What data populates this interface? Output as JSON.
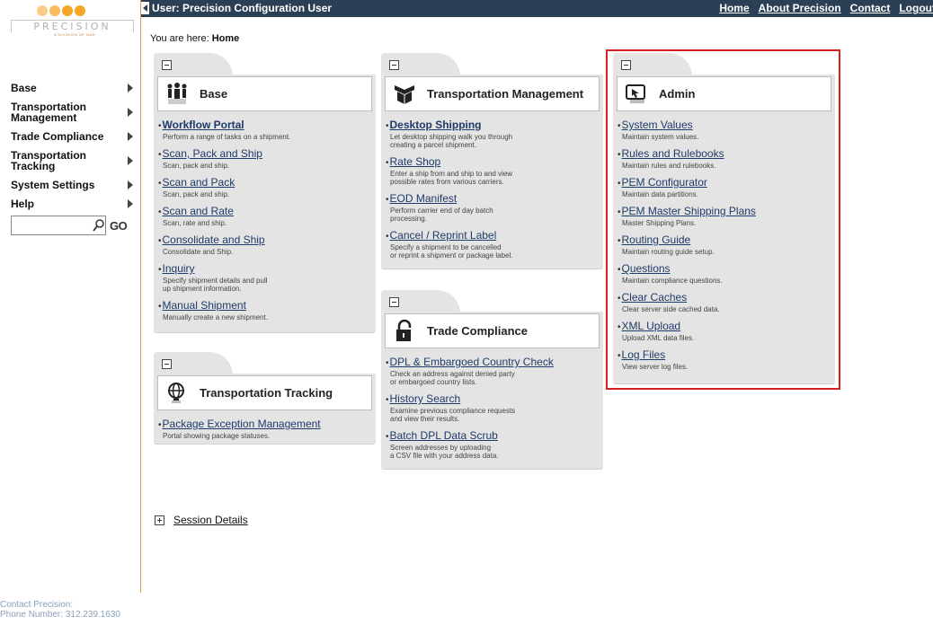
{
  "logo": {
    "text": "PRECISION",
    "sub": "A DIVISION OF GAD"
  },
  "topbar": {
    "user": "User: Precision Configuration User",
    "links": [
      "Home",
      "About Precision",
      "Contact",
      "Logout"
    ]
  },
  "breadcrumb": {
    "prefix": "You are here: ",
    "current": "Home"
  },
  "sidebar": {
    "items": [
      {
        "label": "Base"
      },
      {
        "label": "Transportation\nManagement"
      },
      {
        "label": "Trade Compliance"
      },
      {
        "label": "Transportation\nTracking"
      },
      {
        "label": "System Settings"
      },
      {
        "label": "Help"
      }
    ],
    "search_value": "",
    "go_label": "GO"
  },
  "contact": {
    "line1": "Contact Precision:",
    "line2": "Phone Number: 312.239.1630"
  },
  "panels": {
    "base": {
      "title": "Base",
      "items": [
        {
          "label": "Workflow Portal",
          "desc": "Perform a range of tasks on a shipment.",
          "bold": true
        },
        {
          "label": "Scan, Pack and Ship",
          "desc": "Scan, pack and ship."
        },
        {
          "label": "Scan and Pack",
          "desc": "Scan, pack and ship."
        },
        {
          "label": "Scan and Rate",
          "desc": "Scan, rate and ship."
        },
        {
          "label": "Consolidate and Ship",
          "desc": "Consolidate and Ship."
        },
        {
          "label": "Inquiry",
          "desc": "Specify shipment details and pull\nup shipment information."
        },
        {
          "label": "Manual Shipment",
          "desc": "Manually create a new shipment."
        }
      ]
    },
    "tm": {
      "title": "Transportation Management",
      "items": [
        {
          "label": "Desktop Shipping",
          "desc": "Let desktop shipping walk you through\ncreating a parcel shipment.",
          "bold": true
        },
        {
          "label": "Rate Shop",
          "desc": "Enter a ship from and ship to and view\npossible rates from various carriers."
        },
        {
          "label": "EOD Manifest",
          "desc": "Perform carrier end of day batch\nprocessing."
        },
        {
          "label": "Cancel / Reprint Label",
          "desc": "Specify a shipment to be cancelled\nor reprint a shipment or package label."
        }
      ]
    },
    "admin": {
      "title": "Admin",
      "items": [
        {
          "label": "System Values",
          "desc": "Maintain system values."
        },
        {
          "label": "Rules and Rulebooks",
          "desc": "Maintain rules and rulebooks."
        },
        {
          "label": "PEM Configurator",
          "desc": "Maintain data partitions."
        },
        {
          "label": "PEM Master Shipping Plans",
          "desc": "Master Shipping Plans."
        },
        {
          "label": "Routing Guide",
          "desc": "Maintain routing guide setup."
        },
        {
          "label": "Questions",
          "desc": "Maintain compliance questions."
        },
        {
          "label": "Clear Caches",
          "desc": "Clear server side cached data."
        },
        {
          "label": "XML Upload",
          "desc": "Upload XML data files."
        },
        {
          "label": "Log Files",
          "desc": "View server log files."
        }
      ]
    },
    "tc": {
      "title": "Trade Compliance",
      "items": [
        {
          "label": "DPL & Embargoed Country Check",
          "desc": "Check an address against denied party\nor embargoed country lists."
        },
        {
          "label": "History Search",
          "desc": "Examine previous compliance requests\nand view their results."
        },
        {
          "label": "Batch DPL Data Scrub",
          "desc": "Screen addresses by uploading\na CSV file with your address data."
        }
      ]
    },
    "tt": {
      "title": "Transportation Tracking",
      "items": [
        {
          "label": "Package Exception Management",
          "desc": "Portal showing package statuses."
        }
      ]
    }
  },
  "session": {
    "label": "Session Details"
  },
  "colors": {
    "topbar": "#2b3f55",
    "highlight": "#d42020",
    "link": "#1d3b6a",
    "accent": "#f5a623"
  }
}
